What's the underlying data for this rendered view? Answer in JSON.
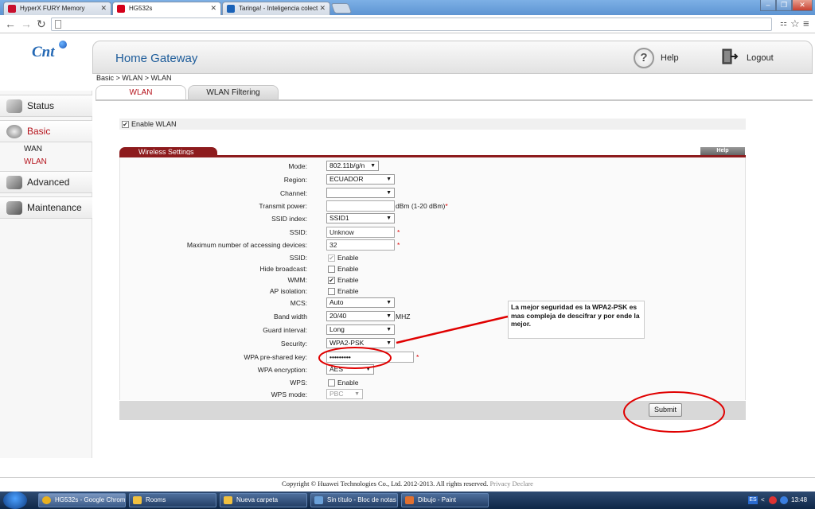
{
  "browser": {
    "tabs": [
      {
        "title": "HyperX FURY Memory",
        "color": "#c8102e"
      },
      {
        "title": "HG532s",
        "color": "#d4001a"
      },
      {
        "title": "Taringa! - Inteligencia colect",
        "color": "#1a62b8"
      }
    ],
    "close_glyph": "✕",
    "window_controls": [
      "–",
      "❐",
      "✕"
    ],
    "page_icon": "page-icon"
  },
  "header": {
    "logo": "Cnt",
    "title": "Home Gateway",
    "help": "Help",
    "logout": "Logout"
  },
  "breadcrumb": "Basic > WLAN > WLAN",
  "subtabs": [
    "WLAN",
    "WLAN Filtering"
  ],
  "sidebar": {
    "items": [
      {
        "label": "Status",
        "icon": "status-icon"
      },
      {
        "label": "Basic",
        "icon": "gear-icon"
      },
      {
        "label": "Advanced",
        "icon": "tools-icon"
      },
      {
        "label": "Maintenance",
        "icon": "maintenance-icon"
      }
    ],
    "subitems": [
      "WAN",
      "WLAN"
    ]
  },
  "enable_wlan": "Enable WLAN",
  "section": {
    "title": "Wireless Settings",
    "help": "Help"
  },
  "form": {
    "mode": {
      "label": "Mode:",
      "value": "802.11b/g/n"
    },
    "region": {
      "label": "Region:",
      "value": "ECUADOR"
    },
    "channel": {
      "label": "Channel:",
      "value": ""
    },
    "transmit_power": {
      "label": "Transmit power:",
      "value": "",
      "unit": "dBm (1-20 dBm)"
    },
    "ssid_index": {
      "label": "SSID index:",
      "value": "SSID1"
    },
    "ssid": {
      "label": "SSID:",
      "value": "Unknow"
    },
    "max_devices": {
      "label": "Maximum number of accessing devices:",
      "value": "32"
    },
    "ssid_enable": {
      "label": "SSID:",
      "text": "Enable"
    },
    "hide_broadcast": {
      "label": "Hide broadcast:",
      "text": "Enable"
    },
    "wmm": {
      "label": "WMM:",
      "text": "Enable"
    },
    "ap_isolation": {
      "label": "AP isolation:",
      "text": "Enable"
    },
    "mcs": {
      "label": "MCS:",
      "value": "Auto"
    },
    "band_width": {
      "label": "Band width",
      "value": "20/40",
      "unit": "MHZ"
    },
    "guard_interval": {
      "label": "Guard interval:",
      "value": "Long"
    },
    "security": {
      "label": "Security:",
      "value": "WPA2-PSK"
    },
    "wpa_key": {
      "label": "WPA pre-shared key:",
      "value": "•••••••••"
    },
    "wpa_encryption": {
      "label": "WPA encryption:",
      "value": "AES"
    },
    "wps": {
      "label": "WPS:",
      "text": "Enable"
    },
    "wps_mode": {
      "label": "WPS mode:",
      "value": "PBC"
    },
    "required_mark": "*",
    "dropdown_arrow": "▼",
    "check_glyph": "✔"
  },
  "submit": "Submit",
  "annotation": "La mejor seguridad es la WPA2-PSK es mas compleja de descifrar y por ende la mejor.",
  "footer": {
    "copyright": "Copyright © Huawei Technologies Co., Ltd. 2012-2013. All rights reserved.",
    "privacy": "Privacy Declare"
  },
  "taskbar": {
    "items": [
      {
        "label": "HG532s - Google Chrome",
        "color": "#e8b020"
      },
      {
        "label": "Rooms",
        "color": "#f0c040"
      },
      {
        "label": "Nueva carpeta",
        "color": "#f0c040"
      },
      {
        "label": "Sin título - Bloc de notas",
        "color": "#6aa0d8"
      },
      {
        "label": "Dibujo - Paint",
        "color": "#e07030"
      }
    ],
    "tray": {
      "lang": "ES",
      "chevron": "<"
    },
    "clock": "13:48"
  },
  "colors": {
    "accent": "#b5121b",
    "section": "#8d1b1d",
    "title_blue": "#1d5c9a",
    "annotation": "#e00000"
  }
}
